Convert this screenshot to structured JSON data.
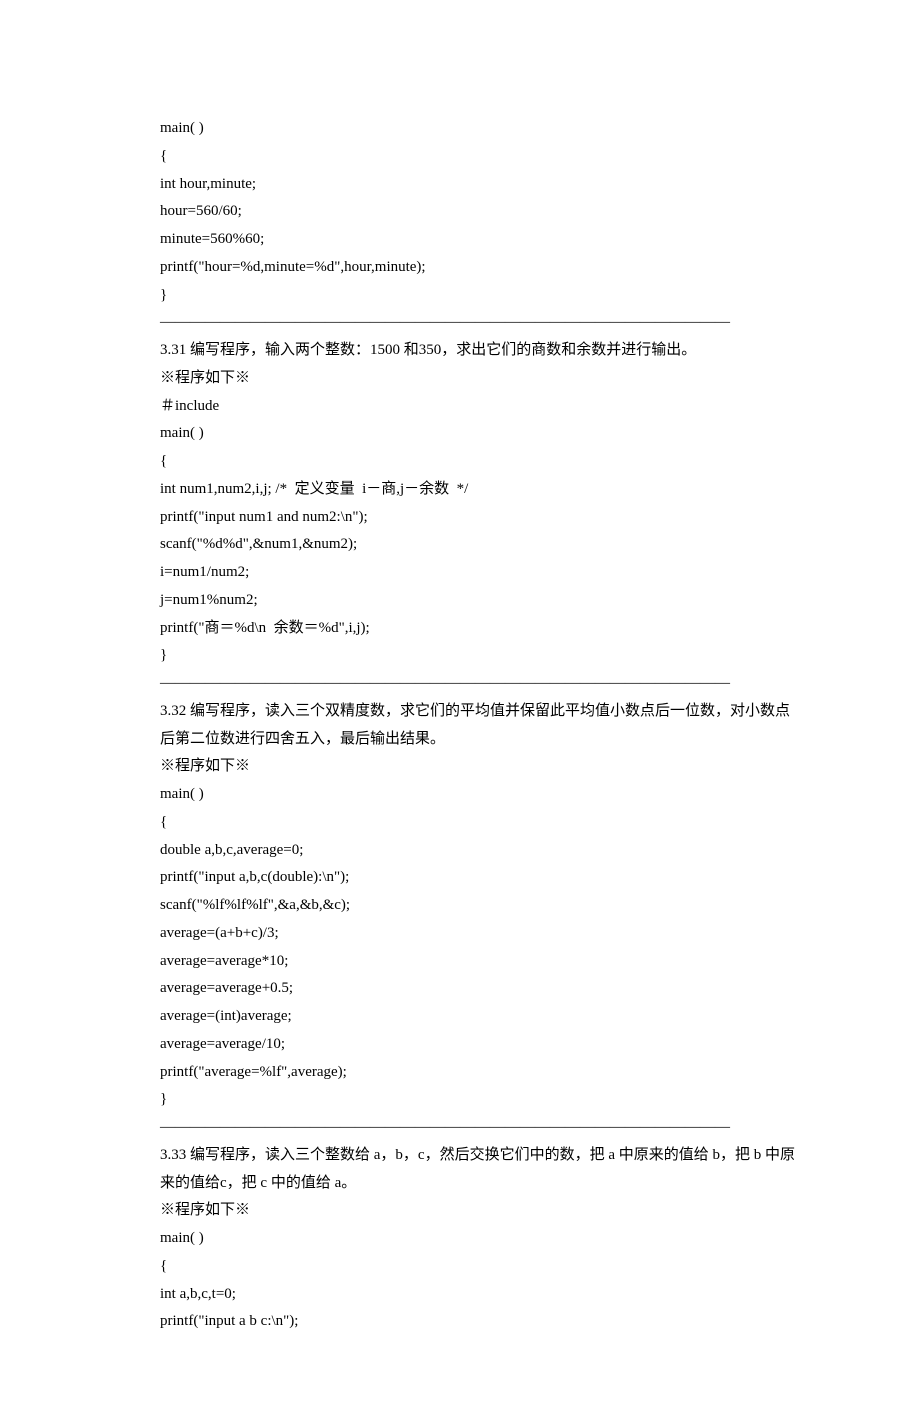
{
  "block0": {
    "lines": [
      "main( )",
      "{",
      "int hour,minute;",
      "hour=560/60;",
      "minute=560%60;",
      "printf(\"hour=%d,minute=%d\",hour,minute);",
      "}"
    ]
  },
  "sep1": "——————————————————————————————————————",
  "q31": {
    "title": "3.31 编写程序，输入两个整数：1500 和350，求出它们的商数和余数并进行输出。",
    "header": "※程序如下※",
    "lines": [
      "＃include",
      "main( )",
      "{",
      "int num1,num2,i,j; /*  定义变量  i－商,j－余数  */",
      "printf(\"input num1 and num2:\\n\");",
      "scanf(\"%d%d\",&num1,&num2);",
      "i=num1/num2;",
      "j=num1%num2;",
      "printf(\"商＝%d\\n  余数＝%d\",i,j);",
      "}"
    ]
  },
  "sep2": "——————————————————————————————————————",
  "q32": {
    "title": "3.32 编写程序，读入三个双精度数，求它们的平均值并保留此平均值小数点后一位数，对小数点后第二位数进行四舍五入，最后输出结果。",
    "header": "※程序如下※",
    "lines": [
      "main( )",
      "{",
      "double a,b,c,average=0;",
      "printf(\"input a,b,c(double):\\n\");",
      "scanf(\"%lf%lf%lf\",&a,&b,&c);",
      "average=(a+b+c)/3;",
      "average=average*10;",
      "average=average+0.5;",
      "average=(int)average;",
      "average=average/10;",
      "printf(\"average=%lf\",average);",
      "}"
    ]
  },
  "sep3": "——————————————————————————————————————",
  "q33": {
    "title": "3.33 编写程序，读入三个整数给 a，b，c，然后交换它们中的数，把 a 中原来的值给 b，把 b 中原来的值给c，把 c 中的值给 a。",
    "header": "※程序如下※",
    "lines": [
      "main( )",
      "{",
      "int a,b,c,t=0;",
      "printf(\"input a b c:\\n\");"
    ]
  }
}
